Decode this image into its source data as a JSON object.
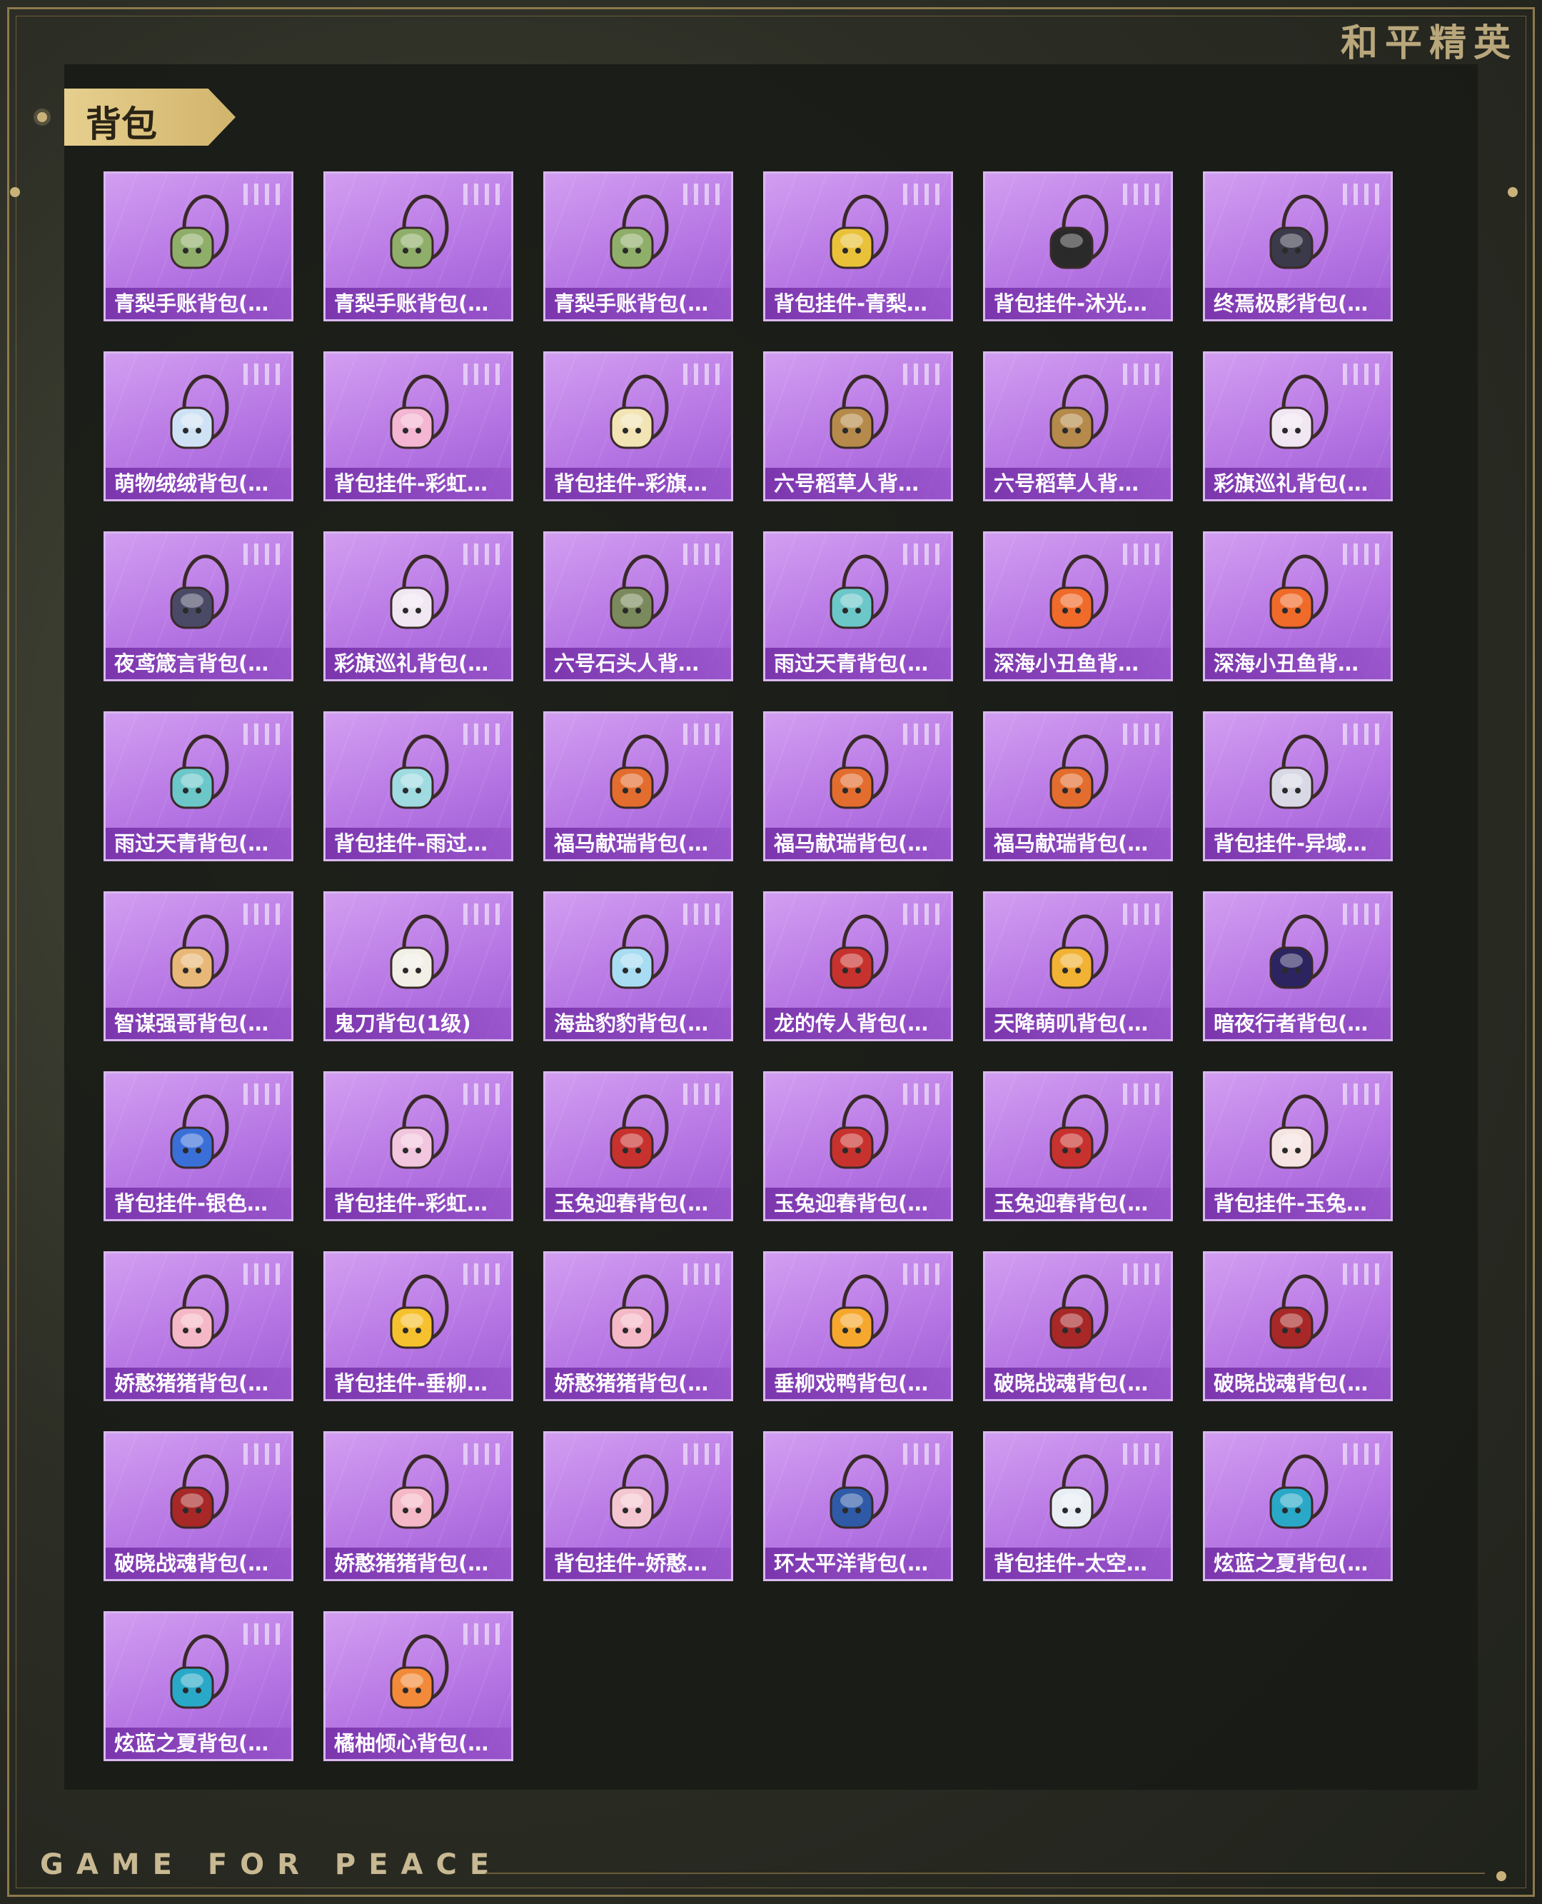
{
  "header": {
    "brand_cn": "和平精英",
    "section_title": "背包"
  },
  "footer": {
    "brand_en": "GAME FOR PEACE"
  },
  "colors": {
    "card_top": "#d29ef1",
    "card_bottom": "#9d5bd3",
    "accent_gold": "#d2b46c"
  },
  "items": [
    {
      "label": "青梨手账背包(…",
      "icon": "green-pouch-backpack-icon",
      "c": "#8fae6a"
    },
    {
      "label": "青梨手账背包(…",
      "icon": "green-pouch-backpack-icon",
      "c": "#8fae6a"
    },
    {
      "label": "青梨手账背包(…",
      "icon": "green-pouch-backpack-icon",
      "c": "#8fae6a"
    },
    {
      "label": "背包挂件-青梨…",
      "icon": "pear-charm-icon",
      "c": "#e9c23a"
    },
    {
      "label": "背包挂件-沐光…",
      "icon": "cat-charm-icon",
      "c": "#2a2a2a"
    },
    {
      "label": "终焉极影背包(…",
      "icon": "dark-shadow-backpack-icon",
      "c": "#3a3a4a"
    },
    {
      "label": "萌物绒绒背包(…",
      "icon": "plush-backpack-icon",
      "c": "#cfe2f5"
    },
    {
      "label": "背包挂件-彩虹…",
      "icon": "bow-charm-icon",
      "c": "#f4b6d2"
    },
    {
      "label": "背包挂件-彩旗…",
      "icon": "ice-cream-charm-icon",
      "c": "#f2e4b4"
    },
    {
      "label": "六号稻草人背…",
      "icon": "scarecrow-backpack-icon",
      "c": "#b58a4a"
    },
    {
      "label": "六号稻草人背…",
      "icon": "scarecrow-backpack-icon",
      "c": "#b58a4a"
    },
    {
      "label": "彩旗巡礼背包(…",
      "icon": "bunny-backpack-icon",
      "c": "#f1e7f3"
    },
    {
      "label": "夜鸢箴言背包(…",
      "icon": "jellyfish-backpack-icon",
      "c": "#4a4a66"
    },
    {
      "label": "彩旗巡礼背包(…",
      "icon": "bunny-backpack-icon",
      "c": "#f1e7f3"
    },
    {
      "label": "六号石头人背…",
      "icon": "stone-backpack-icon",
      "c": "#7b8a5c"
    },
    {
      "label": "雨过天青背包(…",
      "icon": "blue-charm-backpack-icon",
      "c": "#6cc7c9"
    },
    {
      "label": "深海小丑鱼背…",
      "icon": "clownfish-backpack-icon",
      "c": "#f06a2a"
    },
    {
      "label": "深海小丑鱼背…",
      "icon": "clownfish-backpack-icon",
      "c": "#f06a2a"
    },
    {
      "label": "雨过天青背包(…",
      "icon": "blue-charm-backpack-icon",
      "c": "#6cc7c9"
    },
    {
      "label": "背包挂件-雨过…",
      "icon": "blue-stick-charm-icon",
      "c": "#9fdbe0"
    },
    {
      "label": "福马献瑞背包(…",
      "icon": "horse-backpack-icon",
      "c": "#e36d2e"
    },
    {
      "label": "福马献瑞背包(…",
      "icon": "horse-backpack-icon",
      "c": "#e36d2e"
    },
    {
      "label": "福马献瑞背包(…",
      "icon": "horse-backpack-icon",
      "c": "#e36d2e"
    },
    {
      "label": "背包挂件-异域…",
      "icon": "wing-charm-icon",
      "c": "#d9d9e6"
    },
    {
      "label": "智谋强哥背包(…",
      "icon": "egg-face-backpack-icon",
      "c": "#e8b878"
    },
    {
      "label": "鬼刀背包(1级)",
      "icon": "white-backpack-icon",
      "c": "#f2efe6"
    },
    {
      "label": "海盐豹豹背包(…",
      "icon": "seal-backpack-icon",
      "c": "#a8dcf2"
    },
    {
      "label": "龙的传人背包(…",
      "icon": "red-backpack-icon",
      "c": "#c8322e"
    },
    {
      "label": "天降萌叽背包(…",
      "icon": "yellow-backpack-icon",
      "c": "#f2b233"
    },
    {
      "label": "暗夜行者背包(…",
      "icon": "night-walker-backpack-icon",
      "c": "#2b2460"
    },
    {
      "label": "背包挂件-银色…",
      "icon": "walkie-charm-icon",
      "c": "#3b6fd8"
    },
    {
      "label": "背包挂件-彩虹…",
      "icon": "paw-charm-icon",
      "c": "#f2c6de"
    },
    {
      "label": "玉兔迎春背包(…",
      "icon": "red-rabbit-backpack-icon",
      "c": "#c8322e"
    },
    {
      "label": "玉兔迎春背包(…",
      "icon": "red-rabbit-backpack-icon",
      "c": "#c8322e"
    },
    {
      "label": "玉兔迎春背包(…",
      "icon": "red-rabbit-backpack-icon",
      "c": "#c8322e"
    },
    {
      "label": "背包挂件-玉兔…",
      "icon": "rabbit-charm-icon",
      "c": "#f5e4e2"
    },
    {
      "label": "娇憨猪猪背包(…",
      "icon": "pig-backpack-icon",
      "c": "#f4b8c6"
    },
    {
      "label": "背包挂件-垂柳…",
      "icon": "duck-charm-icon",
      "c": "#f6c12e"
    },
    {
      "label": "娇憨猪猪背包(…",
      "icon": "pig-backpack-icon",
      "c": "#f4b8c6"
    },
    {
      "label": "垂柳戏鸭背包(…",
      "icon": "duck-backpack-icon",
      "c": "#f6a82e"
    },
    {
      "label": "破晓战魂背包(…",
      "icon": "dawn-warrior-backpack-icon",
      "c": "#a82828"
    },
    {
      "label": "破晓战魂背包(…",
      "icon": "dawn-warrior-backpack-icon",
      "c": "#a82828"
    },
    {
      "label": "破晓战魂背包(…",
      "icon": "dawn-warrior-backpack-icon",
      "c": "#a82828"
    },
    {
      "label": "娇憨猪猪背包(…",
      "icon": "pig-backpack-icon",
      "c": "#f4b8c6"
    },
    {
      "label": "背包挂件-娇憨…",
      "icon": "pig-charm-icon",
      "c": "#f4c6d2"
    },
    {
      "label": "环太平洋背包(…",
      "icon": "mecha-backpack-icon",
      "c": "#2e5aa8"
    },
    {
      "label": "背包挂件-太空…",
      "icon": "astronaut-charm-icon",
      "c": "#e9eef5"
    },
    {
      "label": "炫蓝之夏背包(…",
      "icon": "blue-summer-backpack-icon",
      "c": "#2aa8c8"
    },
    {
      "label": "炫蓝之夏背包(…",
      "icon": "blue-summer-backpack-icon",
      "c": "#2aa8c8"
    },
    {
      "label": "橘柚倾心背包(…",
      "icon": "orange-heart-backpack-icon",
      "c": "#f28a3a"
    }
  ]
}
